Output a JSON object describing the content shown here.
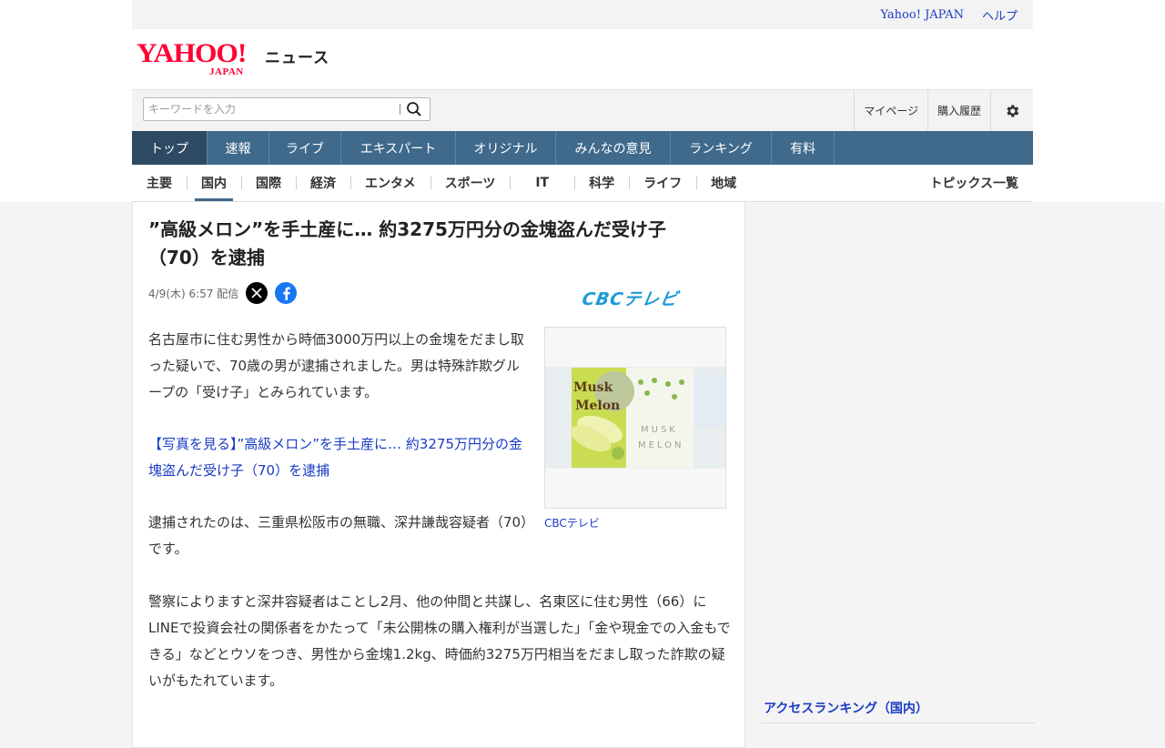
{
  "util": {
    "yahoo_japan": "Yahoo! JAPAN",
    "help": "ヘルプ"
  },
  "brand": {
    "logo_main": "YAHOO!",
    "logo_sub": "JAPAN",
    "section": "ニュース"
  },
  "search": {
    "placeholder": "キーワードを入力",
    "value": ""
  },
  "account": {
    "mypage": "マイページ",
    "history": "購入履歴"
  },
  "global_nav": [
    "トップ",
    "速報",
    "ライブ",
    "エキスパート",
    "オリジナル",
    "みんなの意見",
    "ランキング",
    "有料"
  ],
  "sub_nav": [
    "主要",
    "国内",
    "国際",
    "経済",
    "エンタメ",
    "スポーツ",
    "IT",
    "科学",
    "ライフ",
    "地域"
  ],
  "sub_nav_active": "国内",
  "topics_link": "トピックス一覧",
  "article": {
    "headline": "”高級メロン”を手土産に… 約3275万円分の金塊盗んだ受け子（70）を逮捕",
    "date": "4/9(木) 6:57 配信",
    "source": "CBCテレビ",
    "para1": "名古屋市に住む男性から時価3000万円以上の金塊をだまし取った疑いで、70歳の男が逮捕されました。男は特殊詐欺グループの「受け子」とみられています。",
    "photo_link": "【写真を見る】”高級メロン”を手土産に… 約3275万円分の金塊盗んだ受け子（70）を逮捕",
    "para2": "逮捕されたのは、三重県松阪市の無職、深井謙哉容疑者（70）です。",
    "para3": "警察によりますと深井容疑者はことし2月、他の仲間と共謀し、名東区に住む男性（66）にLINEで投資会社の関係者をかたって「未公開株の購入権利が当選した」「金や現金での入金もできる」などとウソをつき、男性から金塊1.2kg、時価約3275万円相当をだまし取った詐欺の疑いがもたれています。",
    "photo": {
      "caption": "CBCテレビ",
      "box_text_1": "Musk",
      "box_text_2": "Melon",
      "box_text_3": "MUSK",
      "box_text_4": "MELON"
    }
  },
  "sidebar": {
    "ranking_title": "アクセスランキング（国内）"
  },
  "colors": {
    "nav": "#406a8c",
    "nav_active": "#2e4a63",
    "brand_red": "#ff0033",
    "link": "#1a3cc4",
    "cbc": "#1a9bd7"
  },
  "icons": [
    "search-icon",
    "gear-icon",
    "x-icon",
    "facebook-icon"
  ]
}
